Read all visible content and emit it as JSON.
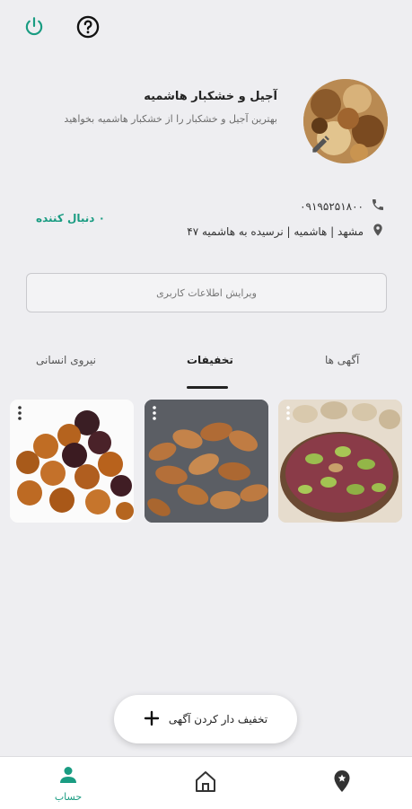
{
  "header": {
    "icons": [
      "power-icon",
      "help-icon"
    ]
  },
  "profile": {
    "shop_name": "آجیل و خشکبار هاشمیه",
    "description": "بهترین آجیل و خشکبار را از خشکبار هاشمیه بخواهید",
    "phone": "۰۹۱۹۵۲۵۱۸۰۰",
    "address": "مشهد | هاشمیه | نرسیده به هاشمیه ۴۷",
    "followers": "۰ دنبال کننده",
    "edit_label": "ویرایش اطلاعات کاربری"
  },
  "tabs": {
    "ads": "آگهی ها",
    "discounts": "تخفیفات",
    "hr": "نیروی انسانی",
    "active": "discounts"
  },
  "cards": [
    {
      "image": "pistachios"
    },
    {
      "image": "almonds"
    },
    {
      "image": "raisins"
    }
  ],
  "fab": {
    "label": "تخفیف دار کردن آگهی"
  },
  "bottom_nav": {
    "account_label": "حساب",
    "active": "account"
  },
  "colors": {
    "accent": "#1a9c82",
    "background": "#eeeef1"
  }
}
